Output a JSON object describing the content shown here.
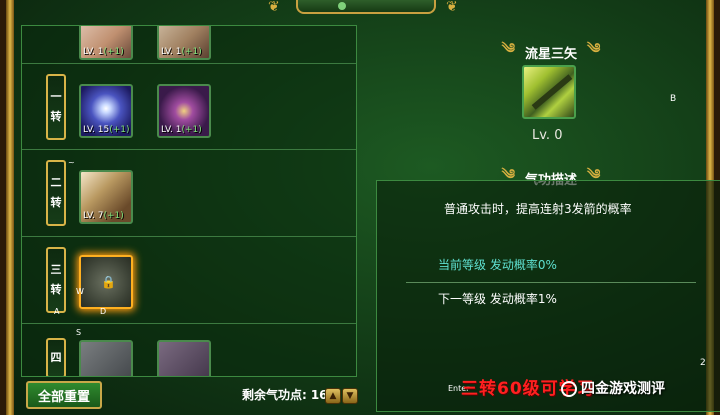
{
  "ranks": [
    {
      "label_1": "一",
      "label_2": "转"
    },
    {
      "label_1": "二",
      "label_2": "转"
    },
    {
      "label_1": "三",
      "label_2": "转"
    },
    {
      "label_1": "四"
    }
  ],
  "skills": {
    "top_1": {
      "level": "LV. 1",
      "bonus": "(+1)"
    },
    "top_2": {
      "level": "LV. 1",
      "bonus": "(+1)"
    },
    "rank1_1": {
      "level": "LV. 15",
      "bonus": "(+1)"
    },
    "rank1_2": {
      "level": "LV. 1",
      "bonus": "(+1)"
    },
    "rank2_1": {
      "level": "LV. 7",
      "bonus": "(+1)"
    }
  },
  "tiny_labels": {
    "w": "W",
    "a": "A",
    "d": "D",
    "s": "S",
    "b": "B",
    "tilde": "~",
    "two": "2",
    "enter": "Enter"
  },
  "footer": {
    "reset_label": "全部重置",
    "points_label": "剩余气功点:",
    "points_value": "16"
  },
  "detail": {
    "skill_name": "流星三矢",
    "skill_level": "Lv. 0",
    "desc_title": "气功描述",
    "description": "普通攻击时，提高连射3发箭的概率",
    "current_level": "当前等级  发动概率0%",
    "next_level": "下一等级  发动概率1%",
    "red_note": "三转60级可学习"
  },
  "watermark": "四金游戏测评",
  "colors": {
    "border_gold": "#d8b448",
    "panel_border": "#3c8a40",
    "current_level_text": "#5ee0d0",
    "red_note": "#ff2020"
  },
  "icons": [
    "cloud-ornament-icon",
    "lock-icon",
    "scroll-up-icon",
    "scroll-down-icon"
  ]
}
